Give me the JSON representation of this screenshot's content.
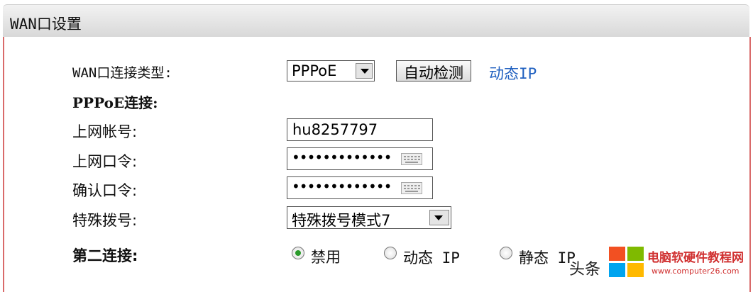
{
  "panel": {
    "title": "WAN口设置"
  },
  "wan": {
    "type_label": "WAN口连接类型:",
    "type_value": "PPPoE",
    "auto_detect_button": "自动检测",
    "detected_link": "动态IP"
  },
  "pppoe": {
    "section_title": "PPPoE连接:",
    "account_label": "上网帐号:",
    "account_value": "hu8257797",
    "password_label": "上网口令:",
    "password_masked": "•••••••••••••",
    "confirm_label": "确认口令:",
    "confirm_masked": "•••••••••••••",
    "dial_label": "特殊拨号:",
    "dial_value": "特殊拨号模式7"
  },
  "second": {
    "label": "第二连接:",
    "options": [
      "禁用",
      "动态 IP",
      "静态 IP"
    ],
    "selected": "禁用"
  },
  "watermark": {
    "prefix": "头条",
    "site": "电脑软硬件教程网",
    "url": "www.computer26.com"
  },
  "colors": {
    "panel_border": "#d96a6a",
    "link": "#2060c0",
    "radio_dot": "#2a9a2a"
  }
}
